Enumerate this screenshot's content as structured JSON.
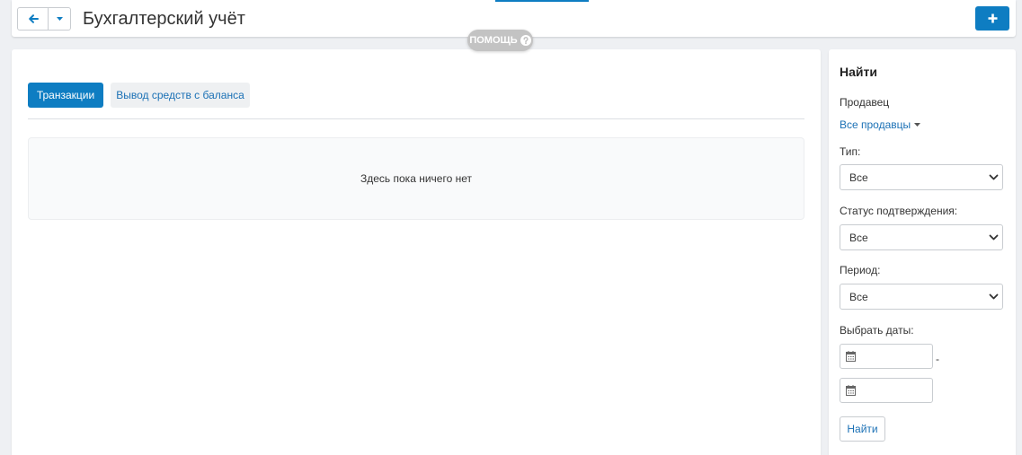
{
  "header": {
    "title": "Бухгалтерский учёт",
    "help_label": "ПОМОЩЬ",
    "icons": {
      "back": "arrow-left-icon",
      "menu": "caret-down-icon",
      "add": "plus-icon",
      "help": "question-circle-icon"
    }
  },
  "tabs": [
    {
      "label": "Транзакции",
      "active": true
    },
    {
      "label": "Вывод средств с баланса",
      "active": false
    }
  ],
  "main": {
    "empty_message": "Здесь пока ничего нет"
  },
  "search": {
    "title": "Найти",
    "vendor": {
      "label": "Продавец",
      "value": "Все продавцы",
      "icon": "caret-down-icon"
    },
    "type": {
      "label": "Тип:",
      "value": "Все",
      "icon": "chevron-down-icon"
    },
    "status": {
      "label": "Статус подтверждения:",
      "value": "Все",
      "icon": "chevron-down-icon"
    },
    "period": {
      "label": "Период:",
      "value": "Все",
      "icon": "chevron-down-icon"
    },
    "dates": {
      "label": "Выбрать даты:",
      "from": "",
      "to": "",
      "separator": "-",
      "icon": "calendar-icon"
    },
    "submit_label": "Найти"
  },
  "colors": {
    "accent": "#0e7dc2",
    "link": "#1a70b5",
    "help_pill": "#c3c3c3",
    "page_background": "#eef0f3"
  }
}
